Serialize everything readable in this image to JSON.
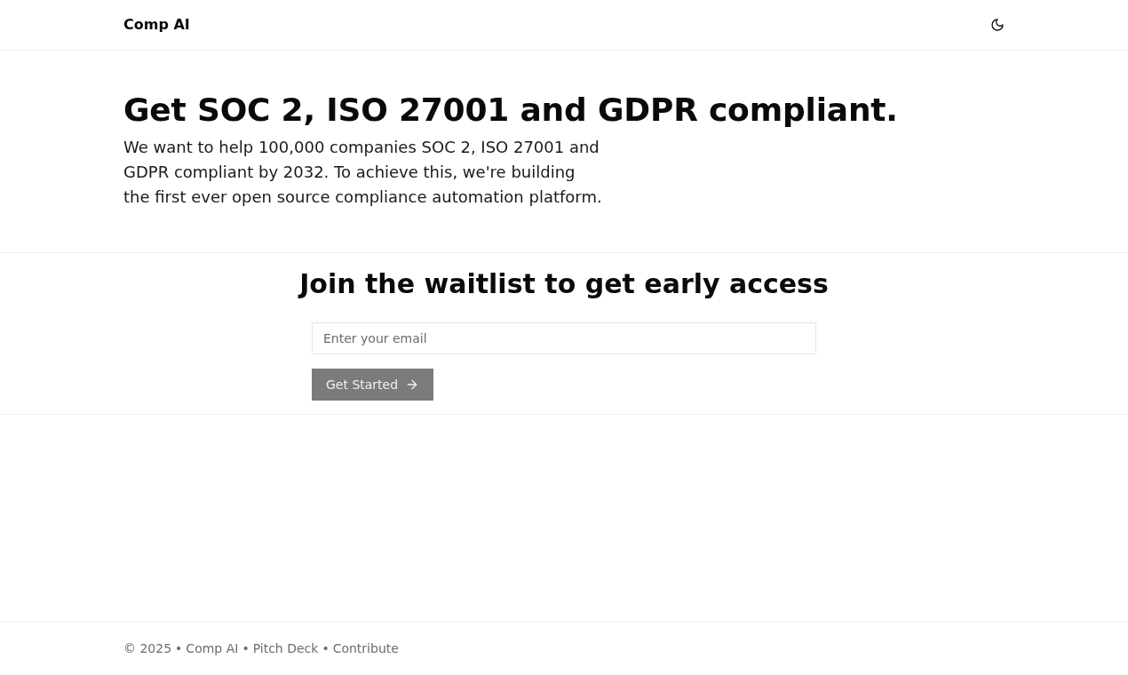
{
  "header": {
    "logo": "Comp AI"
  },
  "hero": {
    "title": "Get SOC 2, ISO 27001 and GDPR compliant.",
    "description": "We want to help 100,000 companies SOC 2, ISO 27001 and GDPR compliant by 2032. To achieve this, we're building the first ever open source compliance automation platform."
  },
  "waitlist": {
    "title": "Join the waitlist to get early access",
    "email_field": {
      "placeholder": "Enter your email"
    },
    "submit_button": {
      "label": "Get Started",
      "disabled": true
    }
  },
  "footer": {
    "copyright": "© 2025",
    "links": [
      "Comp AI",
      "Pitch Deck",
      "Contribute"
    ],
    "separators": [
      "•",
      "•",
      "•"
    ]
  }
}
